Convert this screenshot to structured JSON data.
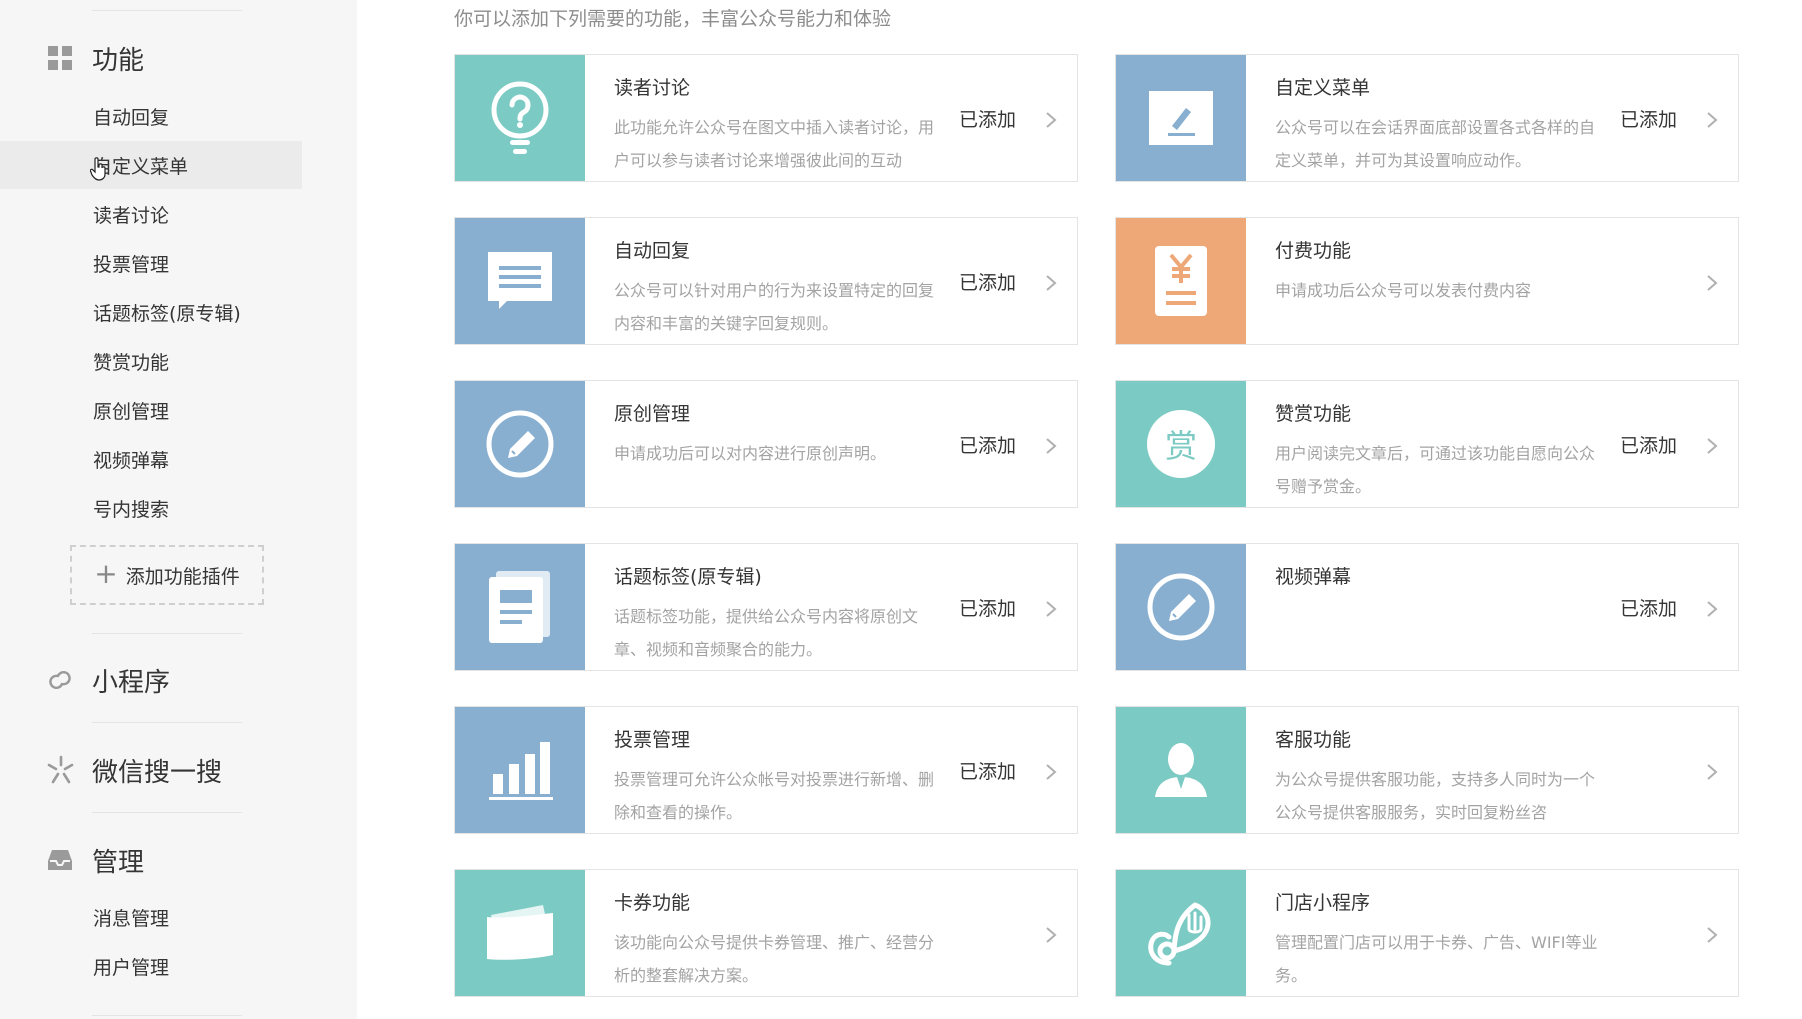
{
  "sidebar": {
    "sections": {
      "features": {
        "label": "功能",
        "icon": "grid-icon"
      },
      "miniprogram": {
        "label": "小程序",
        "icon": "link-icon"
      },
      "search": {
        "label": "微信搜一搜",
        "icon": "sparkle-icon"
      },
      "management": {
        "label": "管理",
        "icon": "inbox-icon"
      }
    },
    "feature_items": [
      {
        "label": "自动回复"
      },
      {
        "label": "自定义菜单"
      },
      {
        "label": "读者讨论"
      },
      {
        "label": "投票管理"
      },
      {
        "label": "话题标签(原专辑)"
      },
      {
        "label": "赞赏功能"
      },
      {
        "label": "原创管理"
      },
      {
        "label": "视频弹幕"
      },
      {
        "label": "号内搜索"
      }
    ],
    "add_plugin_label": "添加功能插件",
    "management_items": [
      {
        "label": "消息管理"
      },
      {
        "label": "用户管理"
      }
    ]
  },
  "main": {
    "intro": "你可以添加下列需要的功能，丰富公众号能力和体验",
    "cards": [
      {
        "title": "读者讨论",
        "desc": "此功能允许公众号在图文中插入读者讨论，用户可以参与读者讨论来增强彼此间的互动",
        "status": "已添加",
        "icon": "question-bulb-icon",
        "color": "#7bcac3"
      },
      {
        "title": "自定义菜单",
        "desc": "公众号可以在会话界面底部设置各式各样的自定义菜单，并可为其设置响应动作。",
        "status": "已添加",
        "icon": "edit-pen-icon",
        "color": "#88afd0"
      },
      {
        "title": "自动回复",
        "desc": "公众号可以针对用户的行为来设置特定的回复内容和丰富的关键字回复规则。",
        "status": "已添加",
        "icon": "message-icon",
        "color": "#88afd0"
      },
      {
        "title": "付费功能",
        "desc": "申请成功后公众号可以发表付费内容",
        "status": "",
        "icon": "yen-document-icon",
        "color": "#eea878"
      },
      {
        "title": "原创管理",
        "desc": "申请成功后可以对内容进行原创声明。",
        "status": "已添加",
        "icon": "pencil-circle-icon",
        "color": "#88afd0"
      },
      {
        "title": "赞赏功能",
        "desc": "用户阅读完文章后，可通过该功能自愿向公众号赠予赏金。",
        "status": "已添加",
        "icon": "reward-icon",
        "color": "#7bcac3",
        "glyph": "赏"
      },
      {
        "title": "话题标签(原专辑)",
        "desc": "话题标签功能，提供给公众号内容将原创文章、视频和音频聚合的能力。",
        "status": "已添加",
        "icon": "book-icon",
        "color": "#88afd0"
      },
      {
        "title": "视频弹幕",
        "desc": "",
        "status": "已添加",
        "icon": "pencil-circle-icon",
        "color": "#88afd0"
      },
      {
        "title": "投票管理",
        "desc": "投票管理可允许公众帐号对投票进行新增、删除和查看的操作。",
        "status": "已添加",
        "icon": "bar-chart-icon",
        "color": "#88afd0"
      },
      {
        "title": "客服功能",
        "desc": "为公众号提供客服功能，支持多人同时为一个公众号提供客服服务，实时回复粉丝咨",
        "status": "",
        "icon": "person-icon",
        "color": "#7bcac3"
      },
      {
        "title": "卡券功能",
        "desc": "该功能向公众号提供卡券管理、推广、经营分析的整套解决方案。",
        "status": "",
        "icon": "card-icon",
        "color": "#7bcac3"
      },
      {
        "title": "门店小程序",
        "desc": "管理配置门店可以用于卡券、广告、WIFI等业务。",
        "status": "",
        "icon": "store-icon",
        "color": "#7bcac3"
      }
    ]
  }
}
